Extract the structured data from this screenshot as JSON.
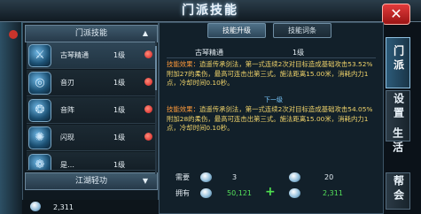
{
  "window": {
    "title": "门派技能",
    "close_glyph": "✕"
  },
  "left_panel": {
    "category_header": "门派技能",
    "category_arrow": "▲",
    "skills": [
      {
        "icon": "sword-wave-skill-icon",
        "glyph": "⚔",
        "name": "古琴精通",
        "level": "1级",
        "selected": true
      },
      {
        "icon": "swirl-skill-icon",
        "glyph": "◎",
        "name": "音刃",
        "level": "1级",
        "selected": false
      },
      {
        "icon": "shield-swirl-skill-icon",
        "glyph": "❂",
        "name": "音阵",
        "level": "1级",
        "selected": false
      },
      {
        "icon": "flash-skill-icon",
        "glyph": "✺",
        "name": "闪现",
        "level": "1级",
        "selected": false
      },
      {
        "icon": "partial-skill-icon",
        "glyph": "❁",
        "name": "是…",
        "level": "1级",
        "selected": false
      }
    ],
    "footer_header": "江湖轻功",
    "footer_arrow": "▼",
    "currency_value": "2,311"
  },
  "right_panel": {
    "tabs": {
      "upgrade": "技能升级",
      "entry": "技能词条"
    },
    "detail": {
      "name": "古琴精通",
      "level": "1级"
    },
    "current_effect": {
      "key": "技能效果：",
      "text": "逍遥传承剑法，第一式连续2次对目标造成基础攻击53.52%附加27的柔伤，最高可连击出第三式。施法距离15.00米，消耗内力1点，冷却时间0.10秒。"
    },
    "next_level_label": "下一级",
    "next_effect": {
      "key": "技能效果：",
      "text": "逍遥传承剑法，第一式连续2次对目标造成基础攻击54.05%附加28的柔伤，最高可连击出第三式。施法距离15.00米，消耗内力1点，冷却时间0.10秒。"
    },
    "requirements": {
      "need_label": "需要",
      "have_label": "拥有",
      "need_values": [
        "3",
        "20"
      ],
      "have_values": [
        "50,121",
        "2,311"
      ],
      "plus": "+"
    }
  },
  "side_tabs": [
    "门派",
    "设置",
    "生活",
    "帮会"
  ],
  "colors": {
    "effect_text": "#f0d36a",
    "effect_key": "#ff9a3a",
    "owned_value": "#54e05a",
    "close_button": "#d22a2a"
  }
}
